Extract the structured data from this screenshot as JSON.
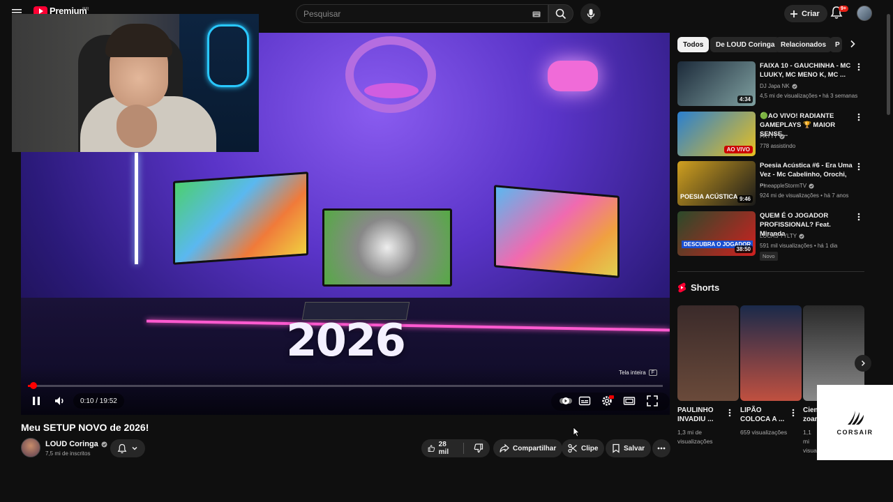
{
  "header": {
    "brand": "Premium",
    "region": "BR",
    "search_placeholder": "Pesquisar",
    "create_label": "Criar",
    "notif_badge": "9+"
  },
  "player": {
    "overlay_text": "2026",
    "time_current": "0:10",
    "time_total": "19:52",
    "time_display": "0:10 / 19:52",
    "progress_fraction": 0.0084,
    "fullscreen_tooltip": "Tela inteira",
    "fullscreen_key": "F"
  },
  "video": {
    "title": "Meu SETUP NOVO de 2026!",
    "channel": "LOUD Coringa",
    "subscribers": "7,5 mi de inscritos",
    "likes": "28 mil",
    "share_label": "Compartilhar",
    "clip_label": "Clipe",
    "save_label": "Salvar"
  },
  "sidebar": {
    "chips": [
      "Todos",
      "De LOUD Coringa",
      "Relacionados",
      "P"
    ],
    "recommendations": [
      {
        "title": "FAIXA 10 - GAUCHINHA - MC LUUKY, MC MENO K, MC ...",
        "channel": "DJ Japa NK",
        "meta": "4,5 mi de visualizações • há 3 semanas",
        "duration": "4:34",
        "color_a": "#1c2a3a",
        "color_b": "#7fa0a0"
      },
      {
        "title": "🟢AO VIVO! RADIANTE GAMEPLAYS 🏆 MAIOR SENSE...",
        "channel": "FRTTT",
        "meta": "778 assistindo",
        "live_label": "AO VIVO",
        "color_a": "#2a7fd0",
        "color_b": "#e8c020"
      },
      {
        "title": "Poesia Acústica #6 - Era Uma Vez - Mc Cabelinho, Orochi, ...",
        "channel": "PineappleStormTV",
        "meta": "924 mi de visualizações • há 7 anos",
        "duration": "9:46",
        "thumb_text": "POESIA ACÚSTICA",
        "color_a": "#d0a020",
        "color_b": "#1a1a1a"
      },
      {
        "title": "QUEM É O JOGADOR PROFISSIONAL? Feat. Miranda",
        "channel": "LUCAS TYLTY",
        "meta": "591 mil visualizações • há 1 dia",
        "duration": "38:50",
        "badge": "Novo",
        "thumb_text": "DESCUBRA O JOGADOR",
        "color_a": "#2a4a2a",
        "color_b": "#d02020"
      }
    ],
    "shorts_heading": "Shorts",
    "shorts": [
      {
        "title": "PAULINHO INVADIU ...",
        "views": "1,3 mi de visualizações",
        "color_a": "#3a2a2a",
        "color_b": "#6a4a3a"
      },
      {
        "title": "LIPÃO COLOCA A ...",
        "views": "659 visualizações",
        "color_a": "#1a2a4a",
        "color_b": "#c05040"
      },
      {
        "title": "Cien zoar",
        "views": "1,1 mi visualizações",
        "color_a": "#2a2a2a",
        "color_b": "#8a8a8a"
      }
    ],
    "ad_brand": "CORSAIR"
  },
  "colors": {
    "accent": "#ff0000",
    "background": "#0f0f0f",
    "chip_bg": "#272727"
  }
}
